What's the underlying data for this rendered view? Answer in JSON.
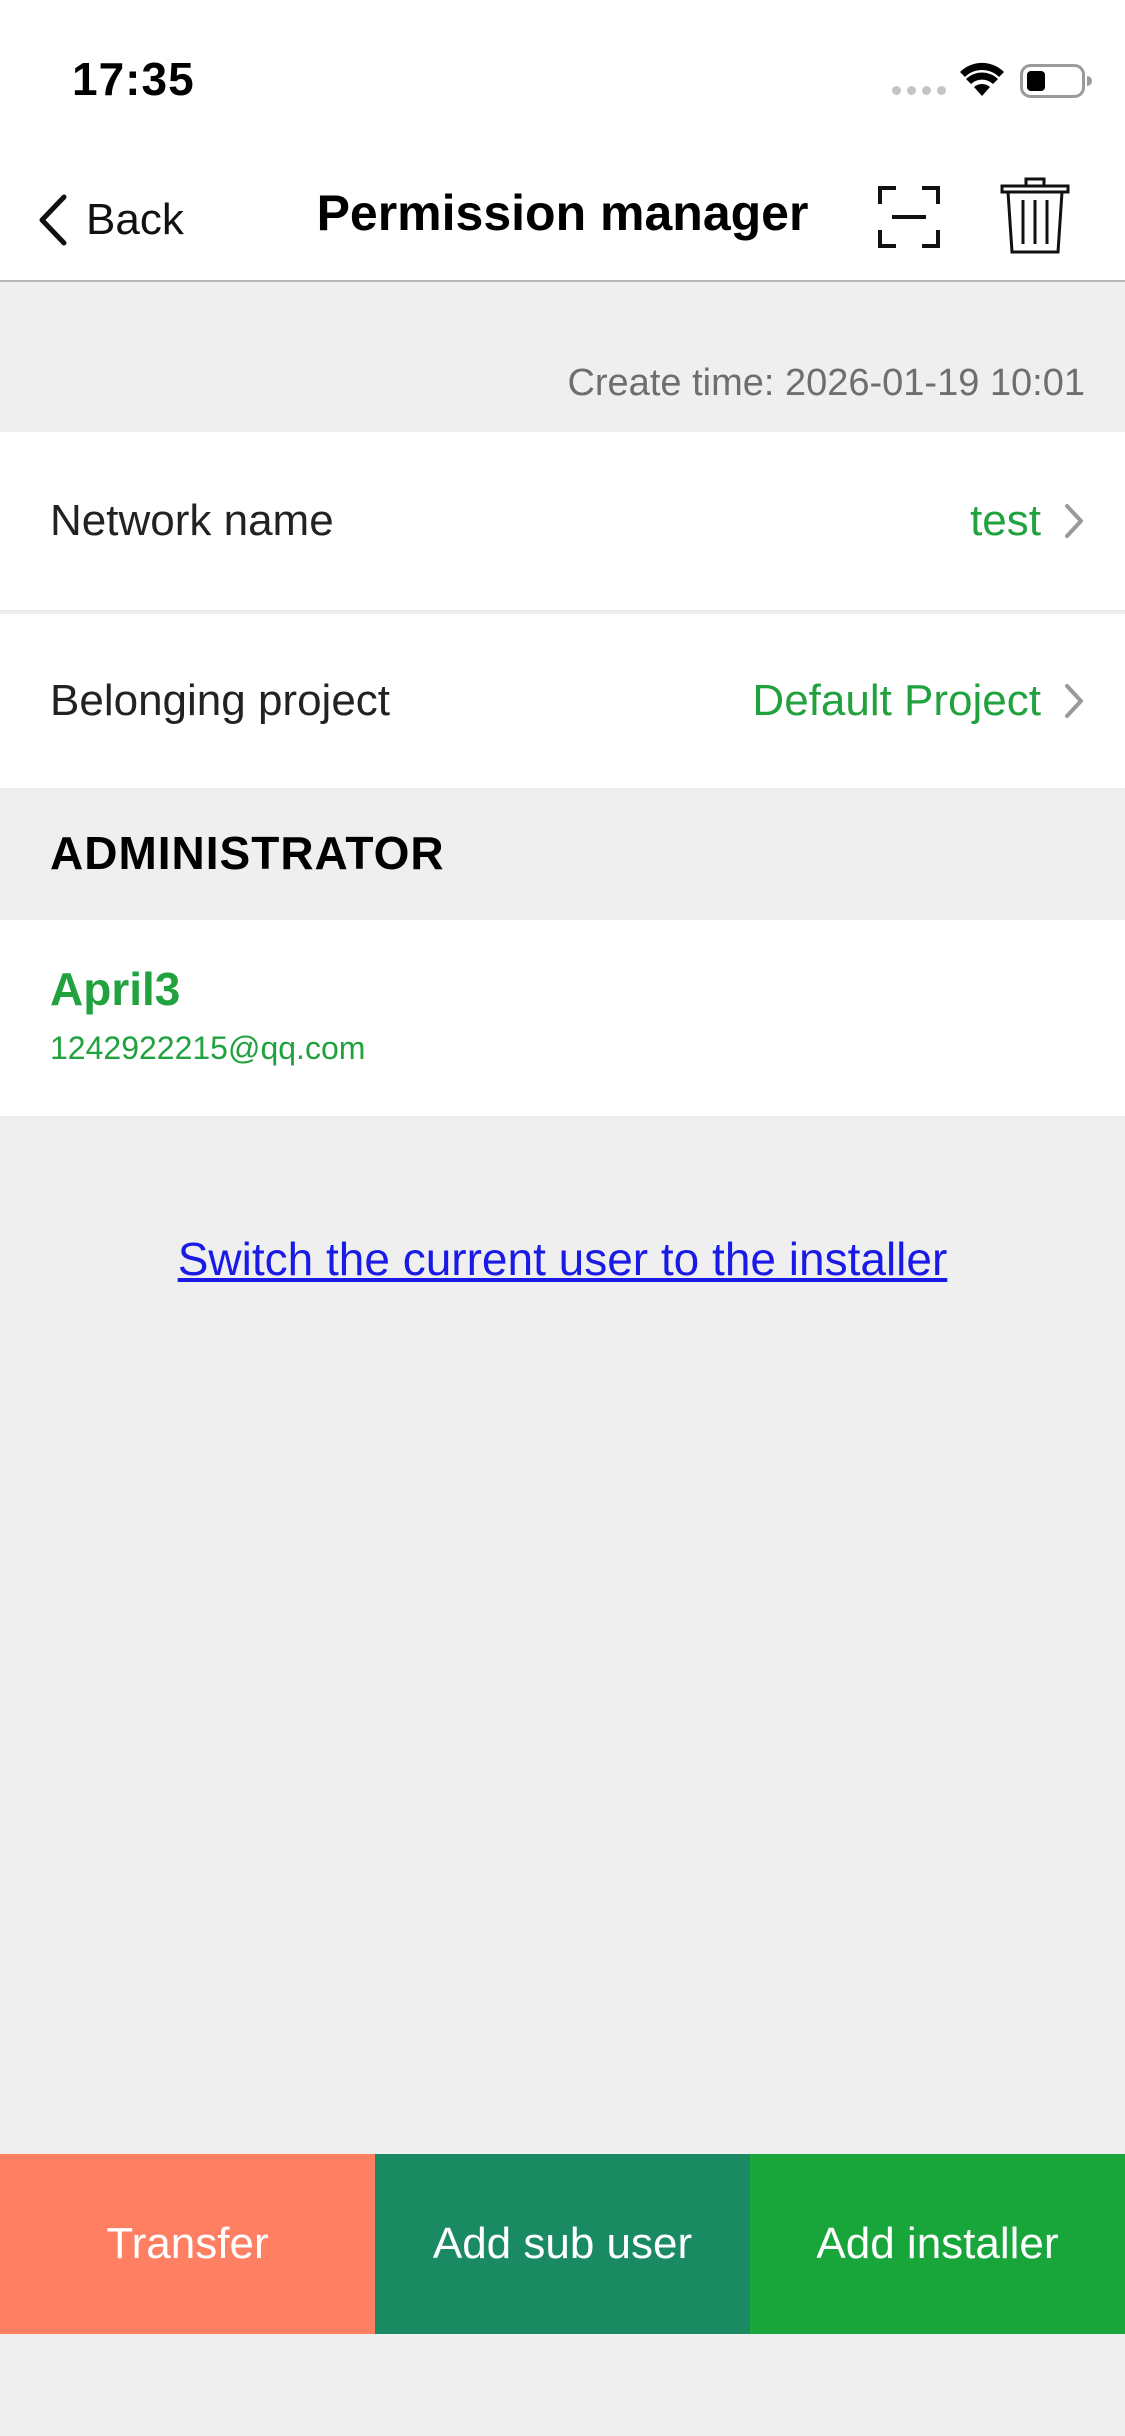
{
  "status_bar": {
    "time": "17:35",
    "icons": [
      "signal-icon",
      "wifi-icon",
      "battery-icon"
    ]
  },
  "nav": {
    "back_label": "Back",
    "title": "Permission manager",
    "actions": [
      "scan-icon",
      "trash-icon"
    ]
  },
  "create_time": "Create time: 2026-01-19 10:01",
  "network": {
    "label": "Network name",
    "value": "test"
  },
  "project": {
    "label": "Belonging project",
    "value": "Default Project"
  },
  "administrator": {
    "header": "ADMINISTRATOR",
    "name": "April3",
    "email": "1242922215@qq.com"
  },
  "switch_link": "Switch the current user to the installer",
  "actions": {
    "transfer": "Transfer",
    "add_sub_user": "Add sub user",
    "add_installer": "Add installer"
  },
  "colors": {
    "accent_green": "#21a23e",
    "link_blue": "#1a1ae6",
    "transfer_bg": "#ff7f63",
    "sub_user_bg": "#1a8a63",
    "installer_bg": "#18a63a"
  }
}
